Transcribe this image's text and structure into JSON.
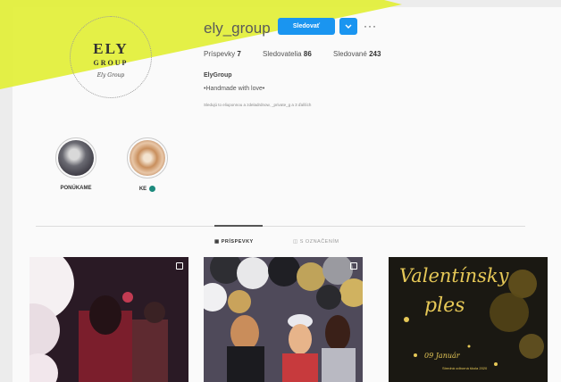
{
  "logo": {
    "line1": "ELY",
    "line2": "GROUP",
    "signature": "Ely Group"
  },
  "profile": {
    "username": "ely_group",
    "follow_label": "Sledovať",
    "more_icon": "chevron-down-icon",
    "options": "···"
  },
  "stats": [
    {
      "label": "Príspevky",
      "value": "7"
    },
    {
      "label": "Sledovatelia",
      "value": "86"
    },
    {
      "label": "Sledované",
      "value": "243"
    }
  ],
  "bio": {
    "name": "ElyGroup",
    "text": "•Handmade with love•",
    "followed_by": "Sledujú to eliuponnou a zdeladrdnow, _private_g a 3 ďalších"
  },
  "highlights": [
    {
      "label": "PONÚKAME"
    },
    {
      "label": "KE"
    }
  ],
  "tabs": [
    {
      "label": "PRÍSPEVKY",
      "icon": "grid-icon"
    },
    {
      "label": "S OZNAČENÍM",
      "icon": "tag-icon"
    }
  ],
  "posts": [
    {
      "kind": "photo"
    },
    {
      "kind": "photo"
    },
    {
      "kind": "poster",
      "title_line1": "Valentínsky",
      "title_line2": "ples",
      "date": "09 Január",
      "sub": "Stredná odborná škola 2020"
    }
  ],
  "colors": {
    "accent": "#1a95f0",
    "highlight_dot": "#1d8a7d",
    "gold": "#e6c857",
    "banner": "#e3ef3d"
  }
}
